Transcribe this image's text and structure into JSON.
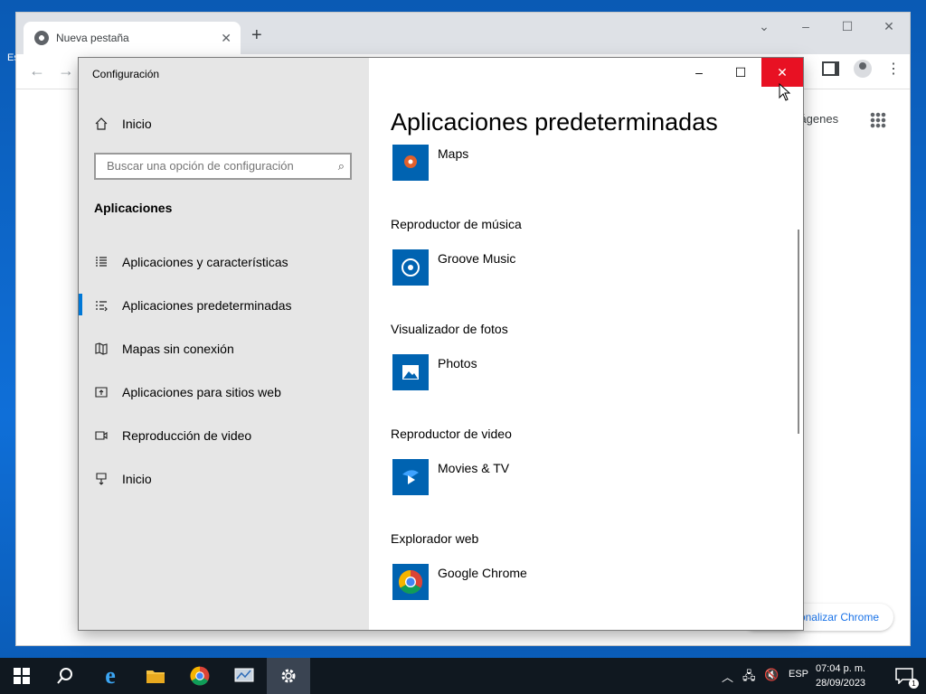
{
  "chrome": {
    "tab_title": "Nueva pestaña",
    "images_link": "Imágenes",
    "customize_label": "Personalizar Chrome"
  },
  "settings": {
    "window_title": "Configuración",
    "search_placeholder": "Buscar una opción de configuración",
    "section_heading": "Aplicaciones",
    "home_label": "Inicio",
    "nav_items": [
      {
        "label": "Aplicaciones y características",
        "icon": "list-icon"
      },
      {
        "label": "Aplicaciones predeterminadas",
        "icon": "default-apps-icon",
        "active": true
      },
      {
        "label": "Mapas sin conexión",
        "icon": "map-icon"
      },
      {
        "label": "Aplicaciones para sitios web",
        "icon": "web-link-icon"
      },
      {
        "label": "Reproducción de video",
        "icon": "video-icon"
      },
      {
        "label": "Inicio",
        "icon": "startup-icon"
      }
    ],
    "page_title": "Aplicaciones predeterminadas",
    "defaults": [
      {
        "category": "",
        "app": "Maps"
      },
      {
        "category": "Reproductor de música",
        "app": "Groove Music"
      },
      {
        "category": "Visualizador de fotos",
        "app": "Photos"
      },
      {
        "category": "Reproductor de video",
        "app": "Movies & TV"
      },
      {
        "category": "Explorador web",
        "app": "Google Chrome"
      }
    ]
  },
  "taskbar": {
    "language": "ESP",
    "time": "07:04 p. m.",
    "date": "28/09/2023",
    "notification_count": "1"
  },
  "colors": {
    "accent": "#0078d7",
    "close_red": "#e81123",
    "tile_blue": "#0063b1"
  }
}
